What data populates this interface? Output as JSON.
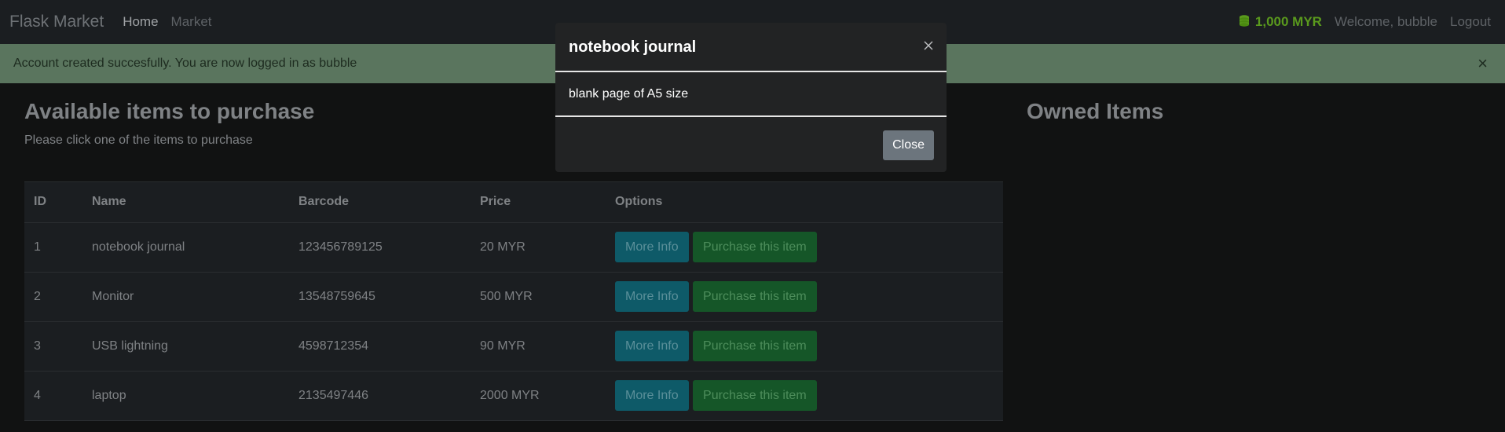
{
  "navbar": {
    "brand": "Flask Market",
    "links": [
      "Home",
      "Market"
    ],
    "budget": "1,000 MYR",
    "welcome": "Welcome, bubble",
    "logout": "Logout",
    "budget_icon": "coins-icon"
  },
  "alert": {
    "message": "Account created succesfully. You are now logged in as bubble",
    "close": "×"
  },
  "left": {
    "title": "Available items to purchase",
    "subtitle": "Please click one of the items to purchase"
  },
  "right": {
    "title": "Owned Items"
  },
  "table": {
    "headers": [
      "ID",
      "Name",
      "Barcode",
      "Price",
      "Options"
    ],
    "rows": [
      {
        "id": "1",
        "name": "notebook journal",
        "barcode": "123456789125",
        "price": "20 MYR"
      },
      {
        "id": "2",
        "name": "Monitor",
        "barcode": "13548759645",
        "price": "500 MYR"
      },
      {
        "id": "3",
        "name": "USB lightning",
        "barcode": "4598712354",
        "price": "90 MYR"
      },
      {
        "id": "4",
        "name": "laptop",
        "barcode": "2135497446",
        "price": "2000 MYR"
      }
    ],
    "more_info_label": "More Info",
    "purchase_label": "Purchase this item"
  },
  "modal": {
    "title": "notebook journal",
    "body": "blank page of A5 size",
    "close_label": "Close",
    "x": "×"
  },
  "colors": {
    "budget": "#5a9a1d",
    "alert_bg": "#5a755e",
    "info_btn": "#0e5a68",
    "success_btn": "#155628",
    "modal_close": "#6c757d"
  }
}
